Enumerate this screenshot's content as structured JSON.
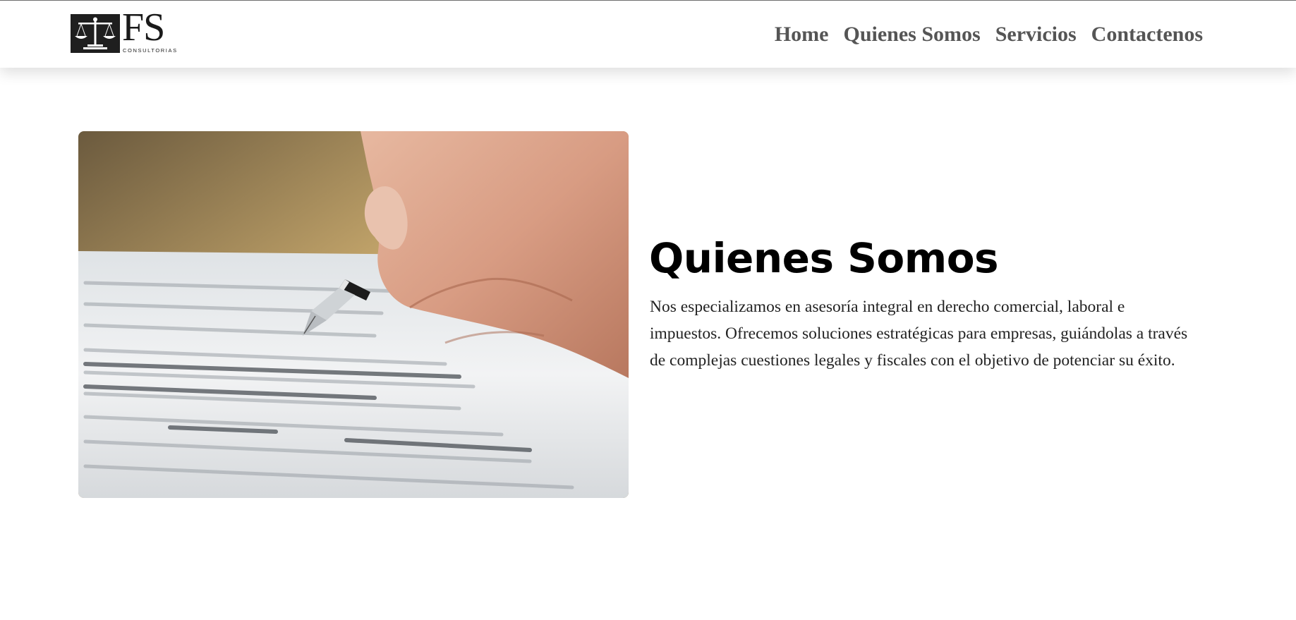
{
  "brand": {
    "letters": "FS",
    "subtitle": "CONSULTORIAS",
    "logo_icon": "scales-of-justice-icon"
  },
  "nav": {
    "items": [
      {
        "label": "Home"
      },
      {
        "label": "Quienes Somos"
      },
      {
        "label": "Servicios"
      },
      {
        "label": "Contactenos"
      }
    ]
  },
  "about": {
    "title": "Quienes Somos",
    "body": "Nos especializamos en asesoría integral en derecho comercial, laboral e impuestos. Ofrecemos soluciones estratégicas para empresas, guiándolas a través de complejas cuestiones legales y fiscales con el objetivo de potenciar su éxito.",
    "image_subject": "hand-signing-contract-with-fountain-pen"
  },
  "colors": {
    "nav_text": "#555555",
    "title_text": "#000000",
    "body_text": "#222222",
    "logo_dark": "#1f1f1f"
  }
}
